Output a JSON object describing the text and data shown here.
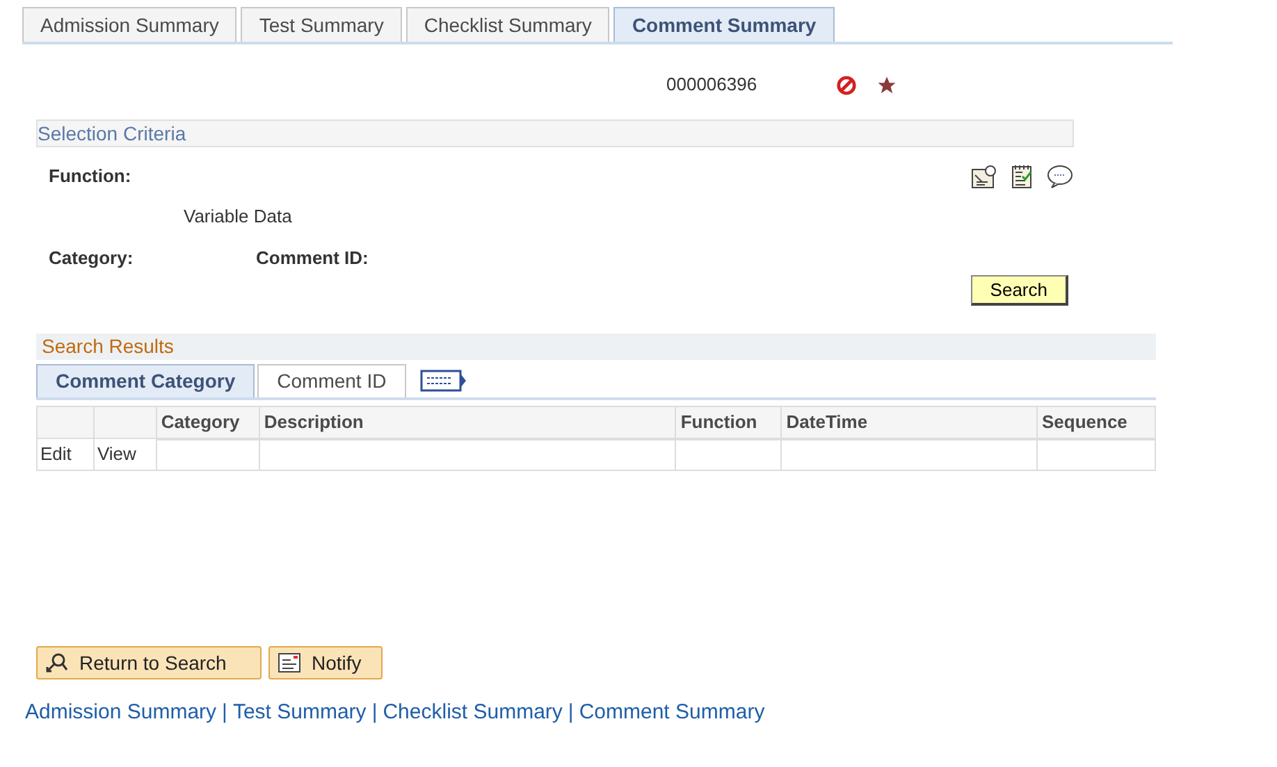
{
  "tabs": [
    {
      "label": "Admission Summary",
      "selected": false
    },
    {
      "label": "Test Summary",
      "selected": false
    },
    {
      "label": "Checklist Summary",
      "selected": false
    },
    {
      "label": "Comment Summary",
      "selected": true
    }
  ],
  "record_id": "000006396",
  "selection_criteria": {
    "title": "Selection Criteria",
    "function_label": "Function:",
    "function_value": "Variable Data",
    "category_label": "Category:",
    "comment_id_label": "Comment ID:",
    "search_button": "Search"
  },
  "search_results": {
    "title": "Search Results",
    "tabs": [
      {
        "label": "Comment Category",
        "selected": true
      },
      {
        "label": "Comment ID",
        "selected": false
      }
    ],
    "columns": [
      "Category",
      "Description",
      "Function",
      "DateTime",
      "Sequence"
    ],
    "rows": [
      {
        "edit": "Edit",
        "view": "View"
      }
    ]
  },
  "buttons": [
    {
      "kind": "return",
      "label": "Return to Search"
    },
    {
      "kind": "notify",
      "label": "Notify"
    }
  ],
  "footer_links": [
    "Admission Summary",
    "Test Summary",
    "Checklist Summary",
    "Comment Summary"
  ],
  "footer_separator": "|"
}
